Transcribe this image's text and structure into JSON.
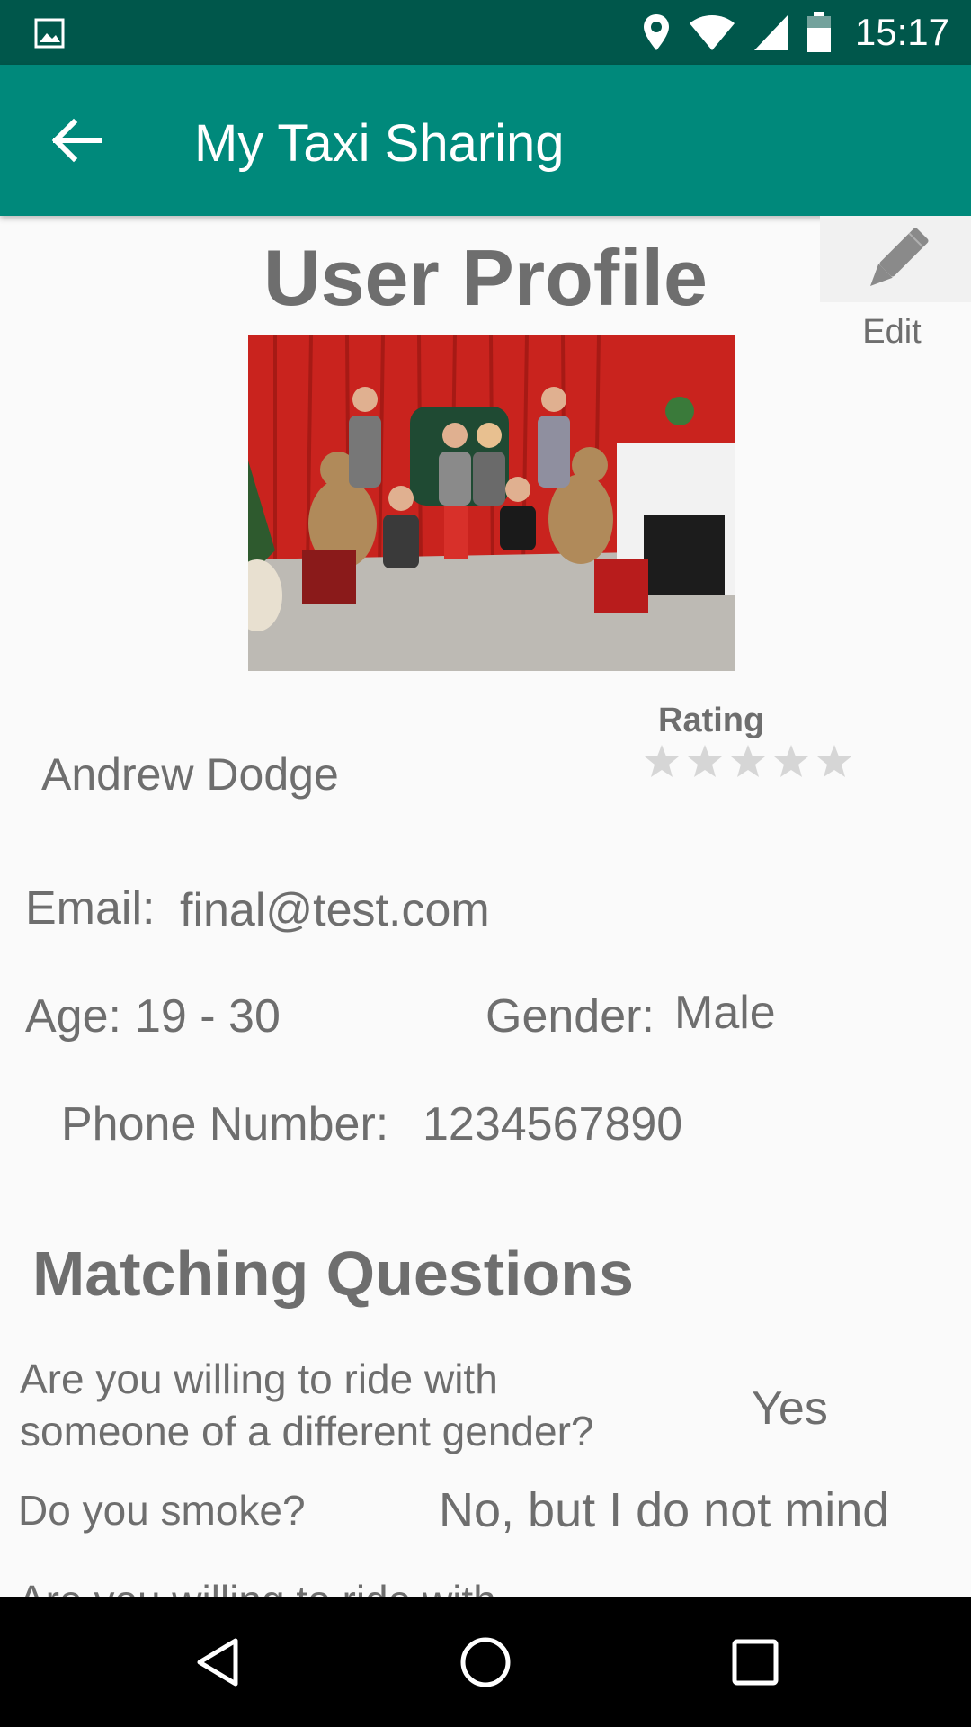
{
  "status_bar": {
    "time": "15:17",
    "icons": [
      "gallery-icon",
      "location-icon",
      "wifi-icon",
      "signal-icon",
      "battery-icon"
    ]
  },
  "app_bar": {
    "title": "My Taxi Sharing",
    "back_icon": "arrow-back-icon"
  },
  "profile": {
    "page_title": "User Profile",
    "edit_label": "Edit",
    "rating_label": "Rating",
    "rating_value": 0,
    "rating_max": 5,
    "name": "Andrew Dodge",
    "email_label": "Email:",
    "email_value": "final@test.com",
    "age_label": "Age:",
    "age_value": "19 - 30",
    "gender_label": "Gender:",
    "gender_value": "Male",
    "phone_label": "Phone Number:",
    "phone_value": "1234567890"
  },
  "matching": {
    "title": "Matching Questions",
    "questions": [
      {
        "question": "Are you willing to ride with someone of a different gender?",
        "answer": "Yes"
      },
      {
        "question": "Do you smoke?",
        "answer": "No, but I do not mind"
      },
      {
        "question": "Are you willing to ride with",
        "answer": ""
      }
    ]
  },
  "colors": {
    "status_bar": "#00574b",
    "app_bar": "#00897b",
    "text": "#6e6e6e",
    "star_empty": "#d6d6d6"
  }
}
